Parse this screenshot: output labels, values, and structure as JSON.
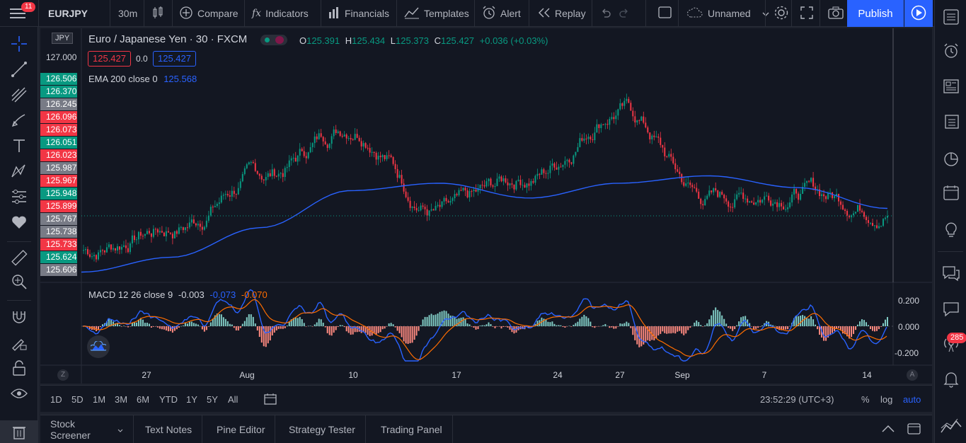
{
  "topbar": {
    "menu_badge": "11",
    "symbol": "EURJPY",
    "interval": "30m",
    "compare": "Compare",
    "indicators": "Indicators",
    "financials": "Financials",
    "templates": "Templates",
    "alert": "Alert",
    "replay": "Replay",
    "layout_name": "Unnamed",
    "publish": "Publish"
  },
  "legend": {
    "title": "Euro / Japanese Yen · 30 · FXCM",
    "o_label": "O",
    "o": "125.391",
    "h_label": "H",
    "h": "125.434",
    "l_label": "L",
    "l": "125.373",
    "c_label": "C",
    "c": "125.427",
    "change": "+0.036 (+0.03%)",
    "sell": "125.427",
    "spread": "0.0",
    "buy": "125.427",
    "ema_label": "EMA 200 close 0",
    "ema_value": "125.568",
    "macd_label": "MACD 12 26 close 9",
    "macd_hist": "-0.003",
    "macd_line": "-0.073",
    "macd_signal": "-0.070"
  },
  "currency_badge": "JPY",
  "price_labels": [
    {
      "value": "127.000",
      "color": "#131722"
    },
    {
      "value": "126.506",
      "color": "#089981"
    },
    {
      "value": "126.370",
      "color": "#089981"
    },
    {
      "value": "126.245",
      "color": "#787b86"
    },
    {
      "value": "126.096",
      "color": "#f23645"
    },
    {
      "value": "126.073",
      "color": "#f23645"
    },
    {
      "value": "126.051",
      "color": "#089981"
    },
    {
      "value": "126.023",
      "color": "#f23645"
    },
    {
      "value": "125.987",
      "color": "#787b86"
    },
    {
      "value": "125.967",
      "color": "#f23645"
    },
    {
      "value": "125.948",
      "color": "#089981"
    },
    {
      "value": "125.899",
      "color": "#f23645"
    },
    {
      "value": "125.767",
      "color": "#787b86"
    },
    {
      "value": "125.738",
      "color": "#787b86"
    },
    {
      "value": "125.733",
      "color": "#f23645"
    },
    {
      "value": "125.624",
      "color": "#089981"
    },
    {
      "value": "125.606",
      "color": "#787b86"
    }
  ],
  "macd_scale": [
    "0.200",
    "0.000",
    "-0.200"
  ],
  "time_axis": [
    "27",
    "Aug",
    "10",
    "17",
    "24",
    "27",
    "Sep",
    "7",
    "14"
  ],
  "time_axis_partial": [
    "Aug"
  ],
  "bottom_bar": {
    "ranges": [
      "1D",
      "5D",
      "1M",
      "3M",
      "6M",
      "YTD",
      "1Y",
      "5Y",
      "All"
    ],
    "clock": "23:52:29 (UTC+3)",
    "percent": "%",
    "log": "log",
    "auto": "auto"
  },
  "bottom_tabs": [
    "Stock Screener",
    "Text Notes",
    "Pine Editor",
    "Strategy Tester",
    "Trading Panel"
  ],
  "notifications_badge": "285",
  "axis_letters": {
    "left": "Z",
    "right": "A"
  },
  "colors": {
    "up": "#089981",
    "down": "#f23645",
    "ema": "#2962ff",
    "macd": "#2962ff",
    "signal": "#ff6d00",
    "accent": "#2962ff"
  },
  "chart_data": {
    "type": "line",
    "title": "Euro / Japanese Yen · 30 · FXCM",
    "xlabel": "",
    "ylabel": "",
    "x": [
      "27",
      "Aug",
      "10",
      "17",
      "24",
      "27",
      "Sep",
      "7",
      "14"
    ],
    "series": [
      {
        "name": "EURJPY",
        "values": [
          125.7,
          125.85,
          126.2,
          126.55,
          125.95,
          126.2,
          126.65,
          126.05,
          126.1,
          125.99
        ]
      },
      {
        "name": "EMA 200 close 0",
        "values": [
          125.55,
          125.65,
          125.85,
          126.1,
          126.15,
          126.05,
          126.15,
          126.2,
          126.12,
          125.98
        ]
      }
    ],
    "macd": {
      "ylim": [
        -0.25,
        0.25
      ]
    },
    "ylim": [
      125.5,
      127.1
    ],
    "grid": false
  }
}
